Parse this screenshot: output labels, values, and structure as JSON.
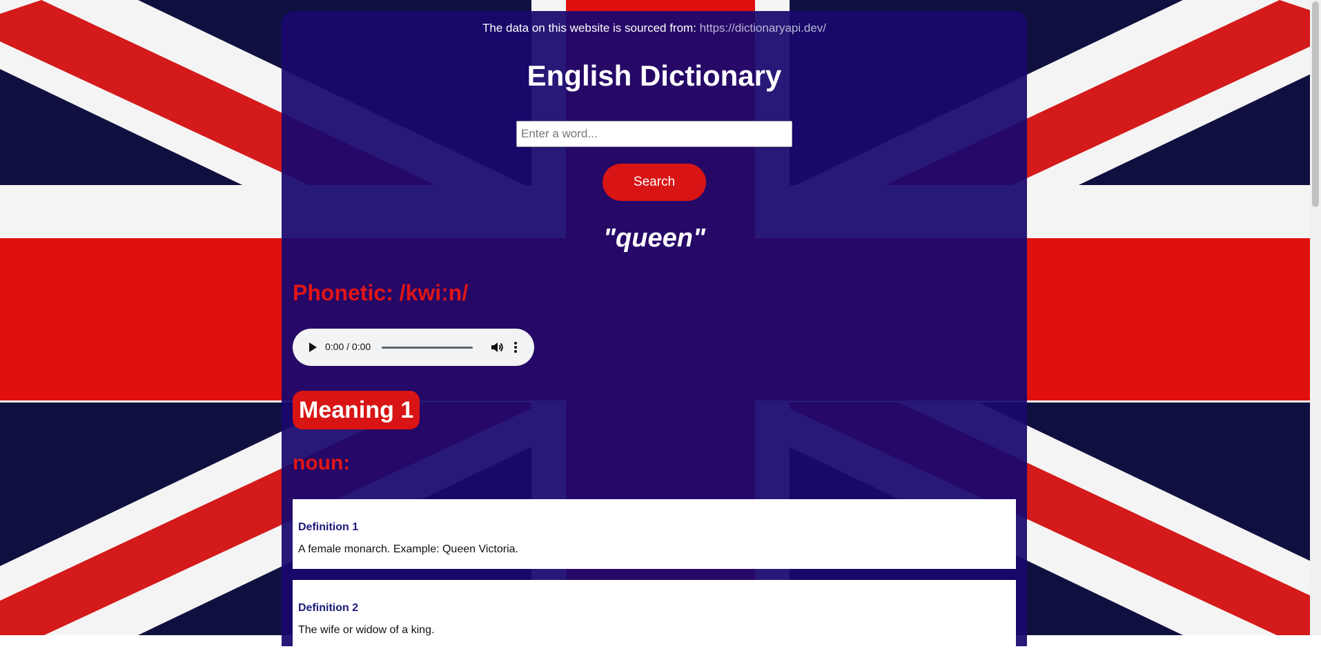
{
  "colors": {
    "panel": "#18086e",
    "accent_red": "#d81414",
    "definition_title": "#1c1a7a"
  },
  "source": {
    "text": "The data on this website is sourced from:",
    "link": "https://dictionaryapi.dev/"
  },
  "title": "English Dictionary",
  "search": {
    "placeholder": "Enter a word...",
    "value": "",
    "button_label": "Search"
  },
  "result": {
    "word": "\"queen\"",
    "phonetic": "Phonetic: /kwiːn/",
    "audio": {
      "time": "0:00 / 0:00",
      "icons": [
        "play-icon",
        "volume-icon",
        "more-options-icon"
      ]
    },
    "meanings": [
      {
        "label": "Meaning 1",
        "part_of_speech": "noun:",
        "definitions": [
          {
            "title": "Definition 1",
            "text": "A female monarch. Example: Queen Victoria."
          },
          {
            "title": "Definition 2",
            "text": "The wife or widow of a king."
          }
        ]
      }
    ]
  }
}
